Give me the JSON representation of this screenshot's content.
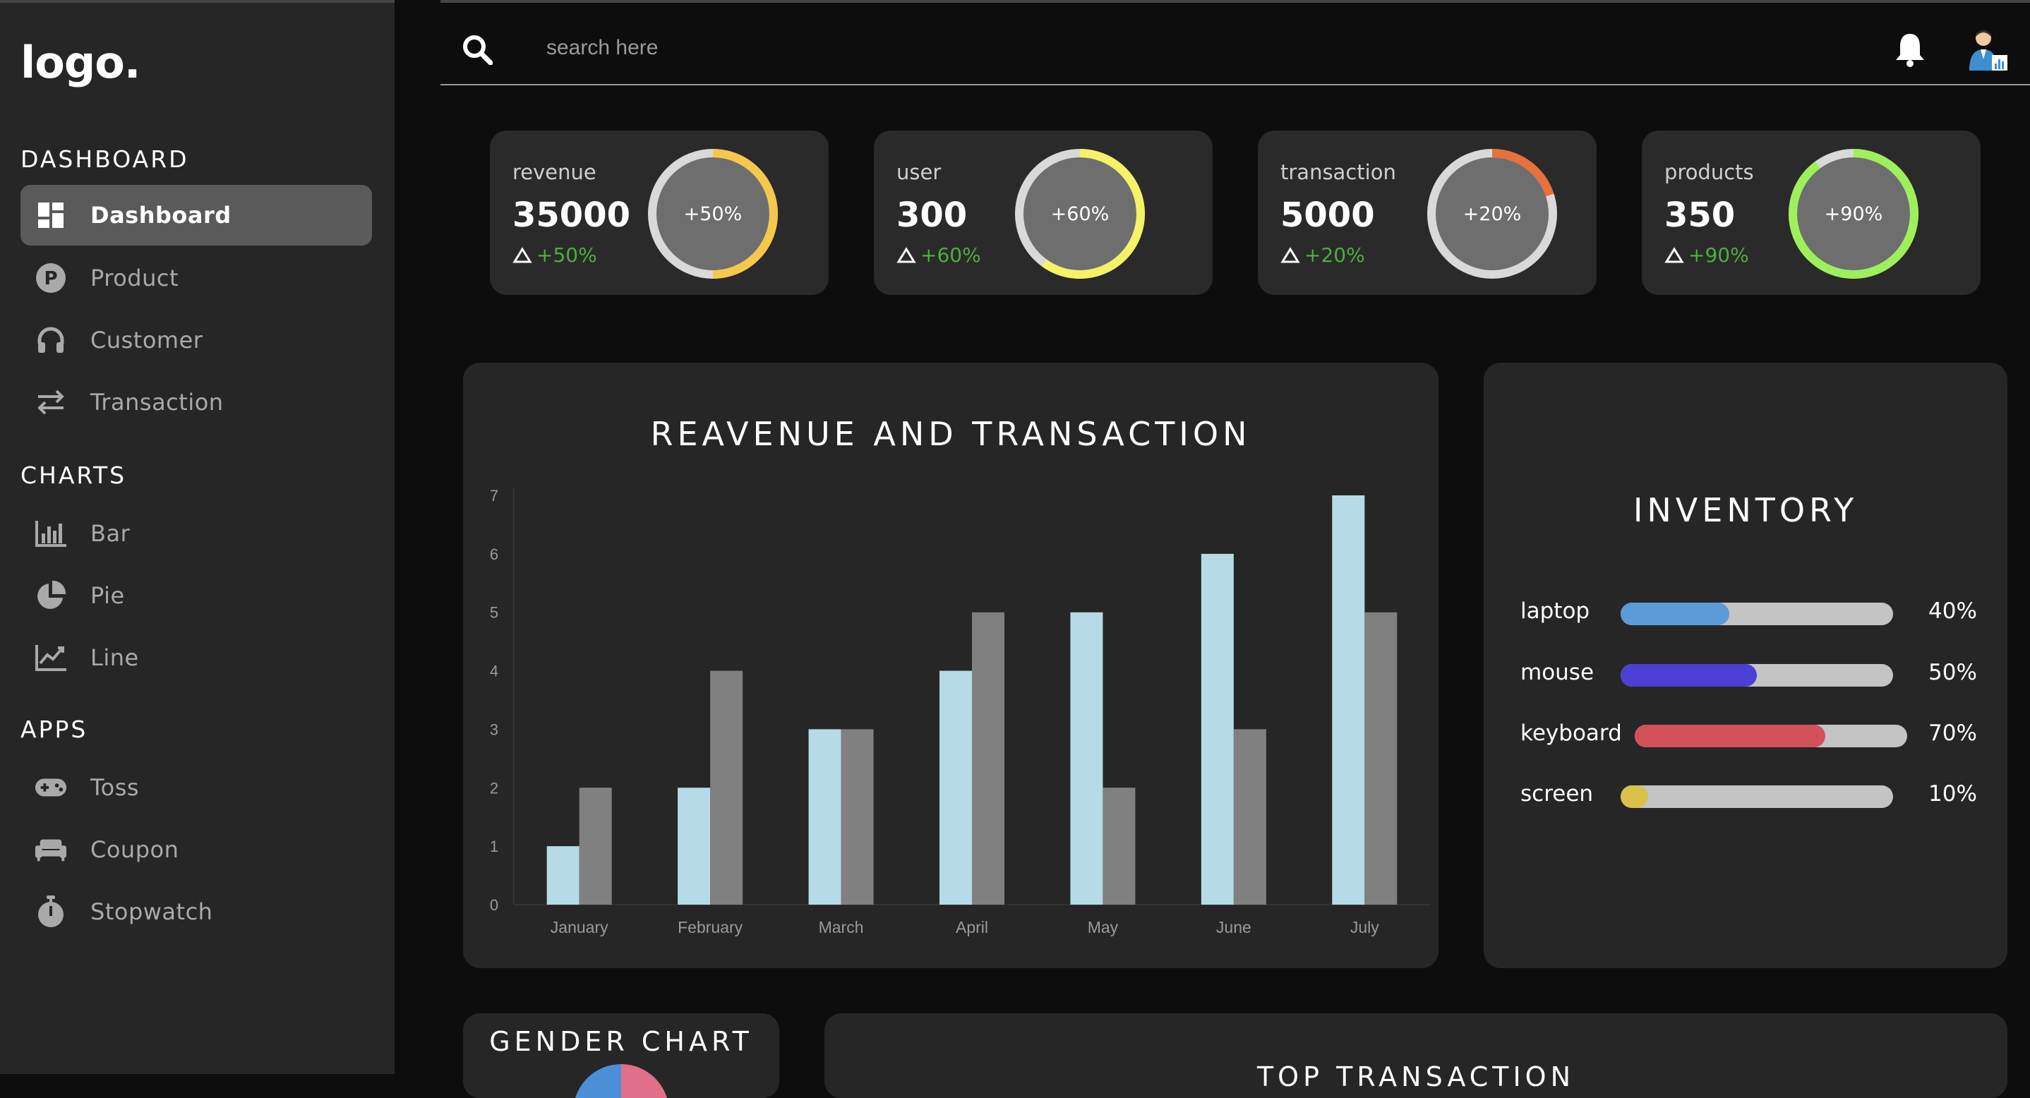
{
  "sidebar": {
    "logo": "logo.",
    "sections": [
      {
        "title": "DASHBOARD",
        "items": [
          {
            "label": "Dashboard",
            "icon": "dashboard-icon",
            "active": true
          },
          {
            "label": "Product",
            "icon": "product-icon"
          },
          {
            "label": "Customer",
            "icon": "headphones-icon"
          },
          {
            "label": "Transaction",
            "icon": "swap-icon"
          }
        ]
      },
      {
        "title": "CHARTS",
        "items": [
          {
            "label": "Bar",
            "icon": "bar-chart-icon"
          },
          {
            "label": "Pie",
            "icon": "pie-chart-icon"
          },
          {
            "label": "Line",
            "icon": "line-chart-icon"
          }
        ]
      },
      {
        "title": "APPS",
        "items": [
          {
            "label": "Toss",
            "icon": "gamepad-icon"
          },
          {
            "label": "Coupon",
            "icon": "couch-icon"
          },
          {
            "label": "Stopwatch",
            "icon": "stopwatch-icon"
          }
        ]
      }
    ]
  },
  "header": {
    "search_placeholder": "search here"
  },
  "stats": [
    {
      "name": "revenue",
      "value": "35000",
      "change": "+50%",
      "ring_label": "+50%",
      "percent": 50,
      "color": "#f5c84c"
    },
    {
      "name": "user",
      "value": "300",
      "change": "+60%",
      "ring_label": "+60%",
      "percent": 60,
      "color": "#f4f267"
    },
    {
      "name": "transaction",
      "value": "5000",
      "change": "+20%",
      "ring_label": "+20%",
      "percent": 20,
      "color": "#e8703a"
    },
    {
      "name": "products",
      "value": "350",
      "change": "+90%",
      "ring_label": "+90%",
      "percent": 90,
      "color": "#9ef05a"
    }
  ],
  "revenue_panel": {
    "title": "REAVENUE AND TRANSACTION"
  },
  "chart_data": {
    "type": "bar",
    "title": "REAVENUE AND TRANSACTION",
    "categories": [
      "January",
      "February",
      "March",
      "April",
      "May",
      "June",
      "July"
    ],
    "series": [
      {
        "values": [
          1,
          2,
          3,
          4,
          5,
          6,
          7
        ],
        "color": "#b6dbe6"
      },
      {
        "values": [
          2,
          4,
          3,
          5,
          2,
          3,
          5
        ],
        "color": "#808080"
      }
    ],
    "yticks": [
      "0",
      "1",
      "2",
      "3",
      "4",
      "5",
      "6",
      "7"
    ],
    "ylim": [
      0,
      7
    ],
    "grid": false,
    "xlabel": "",
    "ylabel": ""
  },
  "inventory": {
    "title": "INVENTORY",
    "items": [
      {
        "label": "laptop",
        "percent_label": "40%",
        "value": 0.4,
        "color": "#5b9bd8"
      },
      {
        "label": "mouse",
        "percent_label": "50%",
        "value": 0.5,
        "color": "#4b3fd6"
      },
      {
        "label": "keyboard",
        "percent_label": "70%",
        "value": 0.7,
        "color": "#d4505a"
      },
      {
        "label": "screen",
        "percent_label": "10%",
        "value": 0.1,
        "color": "#d9c24a"
      }
    ]
  },
  "gender_panel": {
    "title": "GENDER CHART"
  },
  "top_transaction_panel": {
    "title": "TOP TRANSACTION"
  }
}
